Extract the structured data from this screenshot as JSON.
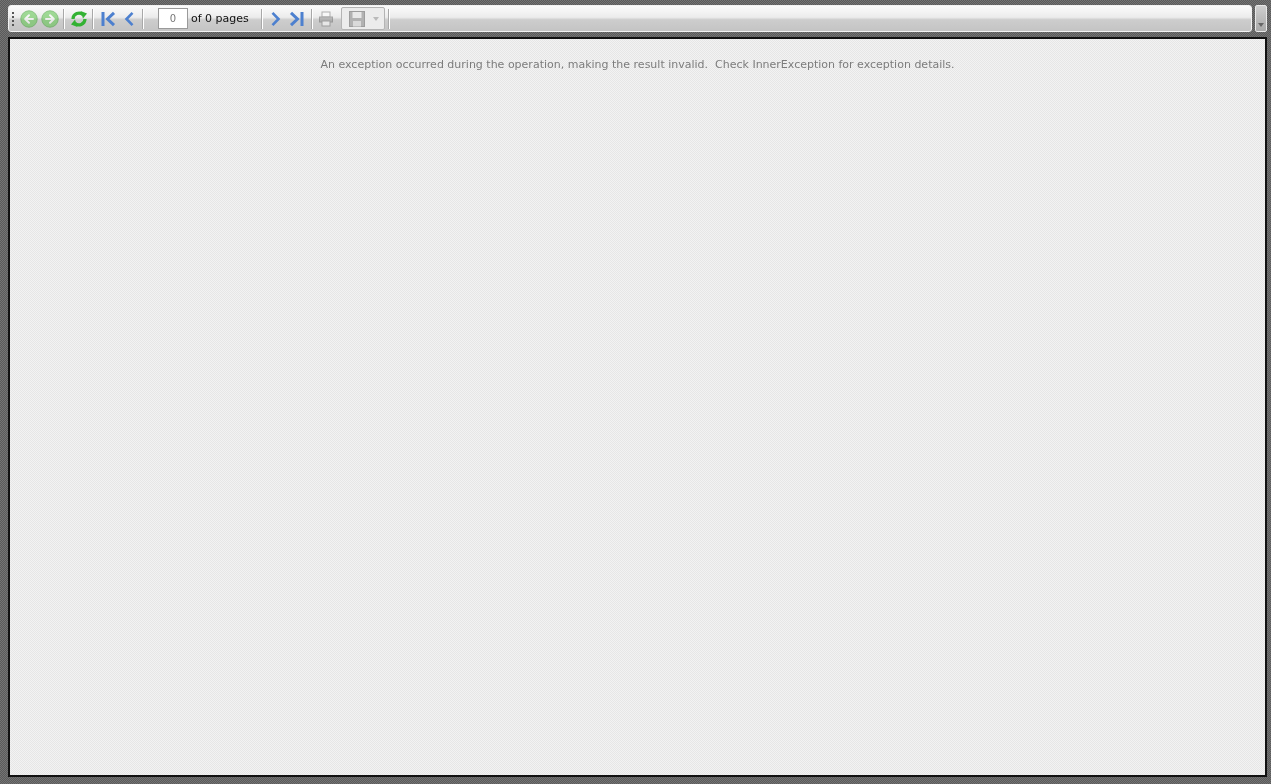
{
  "toolbar": {
    "back_button": {
      "disabled": true
    },
    "forward_button": {
      "disabled": true
    },
    "refresh_button": {
      "disabled": false
    },
    "first_page_button": {
      "disabled": false
    },
    "previous_page_button": {
      "disabled": false
    },
    "page_field": {
      "value": "0"
    },
    "page_count": "of 0 pages",
    "next_page_button": {
      "disabled": false
    },
    "last_page_button": {
      "disabled": false
    },
    "print_button": {
      "disabled": true
    },
    "export_button": {
      "disabled": true
    }
  },
  "report": {
    "message": "An exception occurred during the operation, making the result invalid.  Check InnerException for exception details."
  }
}
